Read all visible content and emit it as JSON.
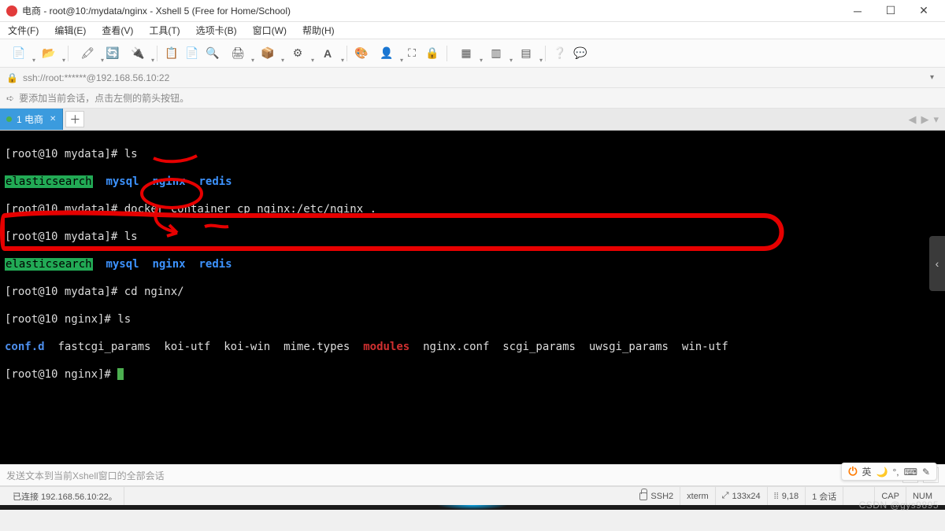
{
  "window": {
    "title": "电商 - root@10:/mydata/nginx - Xshell 5 (Free for Home/School)"
  },
  "menu": {
    "items": [
      "文件(F)",
      "编辑(E)",
      "查看(V)",
      "工具(T)",
      "选项卡(B)",
      "窗口(W)",
      "帮助(H)"
    ]
  },
  "address": {
    "text": "ssh://root:******@192.168.56.10:22"
  },
  "info": {
    "text": "要添加当前会话，点击左侧的箭头按钮。"
  },
  "tabs": {
    "items": [
      {
        "label": "1 电商",
        "active": true
      }
    ]
  },
  "terminal": {
    "lines_prefix": "[root@10 mydata]# ",
    "lines_prefix_nginx": "[root@10 nginx]# ",
    "cmd_ls": "ls",
    "dir_line": {
      "elasticsearch": "elasticsearch",
      "mysql": "mysql",
      "nginx": "nginx",
      "redis": "redis"
    },
    "cmd_docker": "docker container cp nginx:/etc/nginx .",
    "cmd_cd": "cd nginx/",
    "ls_out": {
      "confd": "conf.d",
      "fastcgi": "fastcgi_params",
      "koiutf": "koi-utf",
      "koiwin": "koi-win",
      "mime": "mime.types",
      "modules": "modules",
      "nginxconf": "nginx.conf",
      "scgi": "scgi_params",
      "uwsgi": "uwsgi_params",
      "winutf": "win-utf"
    }
  },
  "sendbar": {
    "placeholder": "发送文本到当前Xshell窗口的全部会话"
  },
  "status": {
    "connected": "已连接 192.168.56.10:22。",
    "ssh": "SSH2",
    "encoding": "xterm",
    "size": "133x24",
    "cursor_label_prefix": "",
    "cursor": "9,18",
    "session": "1 会话",
    "cap": "CAP",
    "num": "NUM",
    "size_icon": "⤢",
    "cursor_icon": "⁞⁞"
  },
  "ime": {
    "label": "英"
  },
  "watermark": "CSDN @gys9895"
}
